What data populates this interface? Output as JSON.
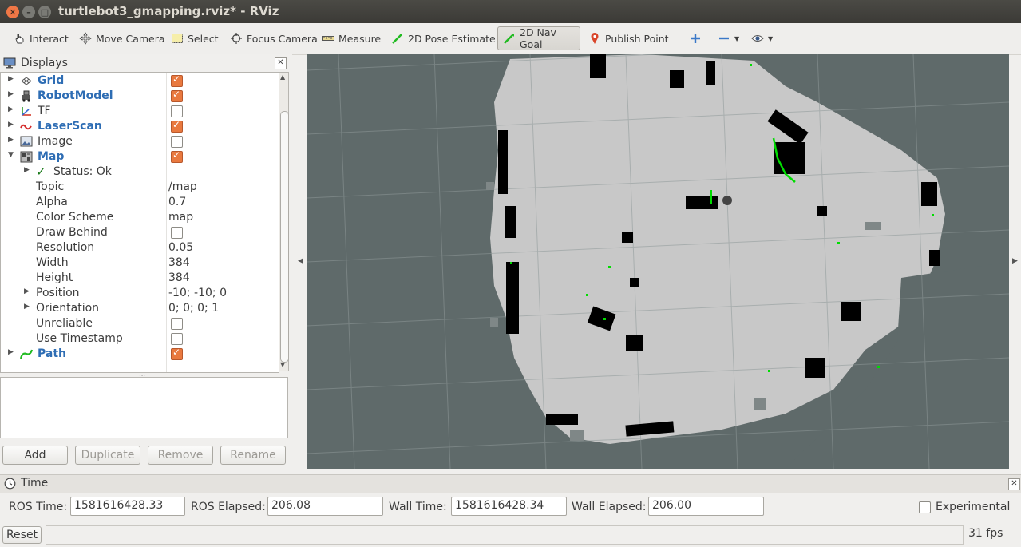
{
  "window": {
    "title": "turtlebot3_gmapping.rviz* - RViz"
  },
  "toolbar": {
    "interact": "Interact",
    "move_camera": "Move Camera",
    "select": "Select",
    "focus_camera": "Focus Camera",
    "measure": "Measure",
    "pose_estimate": "2D Pose Estimate",
    "nav_goal": "2D Nav Goal",
    "publish_point": "Publish Point"
  },
  "displays": {
    "title": "Displays",
    "items": [
      {
        "label": "Grid",
        "checked": true
      },
      {
        "label": "RobotModel",
        "checked": true
      },
      {
        "label": "TF",
        "checked": false
      },
      {
        "label": "LaserScan",
        "checked": true
      },
      {
        "label": "Image",
        "checked": false
      },
      {
        "label": "Map",
        "checked": true
      }
    ],
    "map_props": {
      "status": "Status: Ok",
      "topic_label": "Topic",
      "topic_value": "/map",
      "alpha_label": "Alpha",
      "alpha_value": "0.7",
      "color_scheme_label": "Color Scheme",
      "color_scheme_value": "map",
      "draw_behind_label": "Draw Behind",
      "resolution_label": "Resolution",
      "resolution_value": "0.05",
      "width_label": "Width",
      "width_value": "384",
      "height_label": "Height",
      "height_value": "384",
      "position_label": "Position",
      "position_value": "-10; -10; 0",
      "orientation_label": "Orientation",
      "orientation_value": "0; 0; 0; 1",
      "unreliable_label": "Unreliable",
      "use_timestamp_label": "Use Timestamp"
    },
    "path": {
      "label": "Path",
      "checked": true
    },
    "buttons": {
      "add": "Add",
      "duplicate": "Duplicate",
      "remove": "Remove",
      "rename": "Rename"
    }
  },
  "time": {
    "title": "Time",
    "ros_time_label": "ROS Time:",
    "ros_time_value": "1581616428.33",
    "ros_elapsed_label": "ROS Elapsed:",
    "ros_elapsed_value": "206.08",
    "wall_time_label": "Wall Time:",
    "wall_time_value": "1581616428.34",
    "wall_elapsed_label": "Wall Elapsed:",
    "wall_elapsed_value": "206.00",
    "experimental_label": "Experimental"
  },
  "status": {
    "reset": "Reset",
    "fps": "31 fps"
  },
  "colors": {
    "accent_orange": "#e9793f",
    "map_free": "#c8c8c8",
    "map_unknown": "#5f6a6a",
    "map_occupied": "#000000",
    "path_green": "#00dd00"
  }
}
